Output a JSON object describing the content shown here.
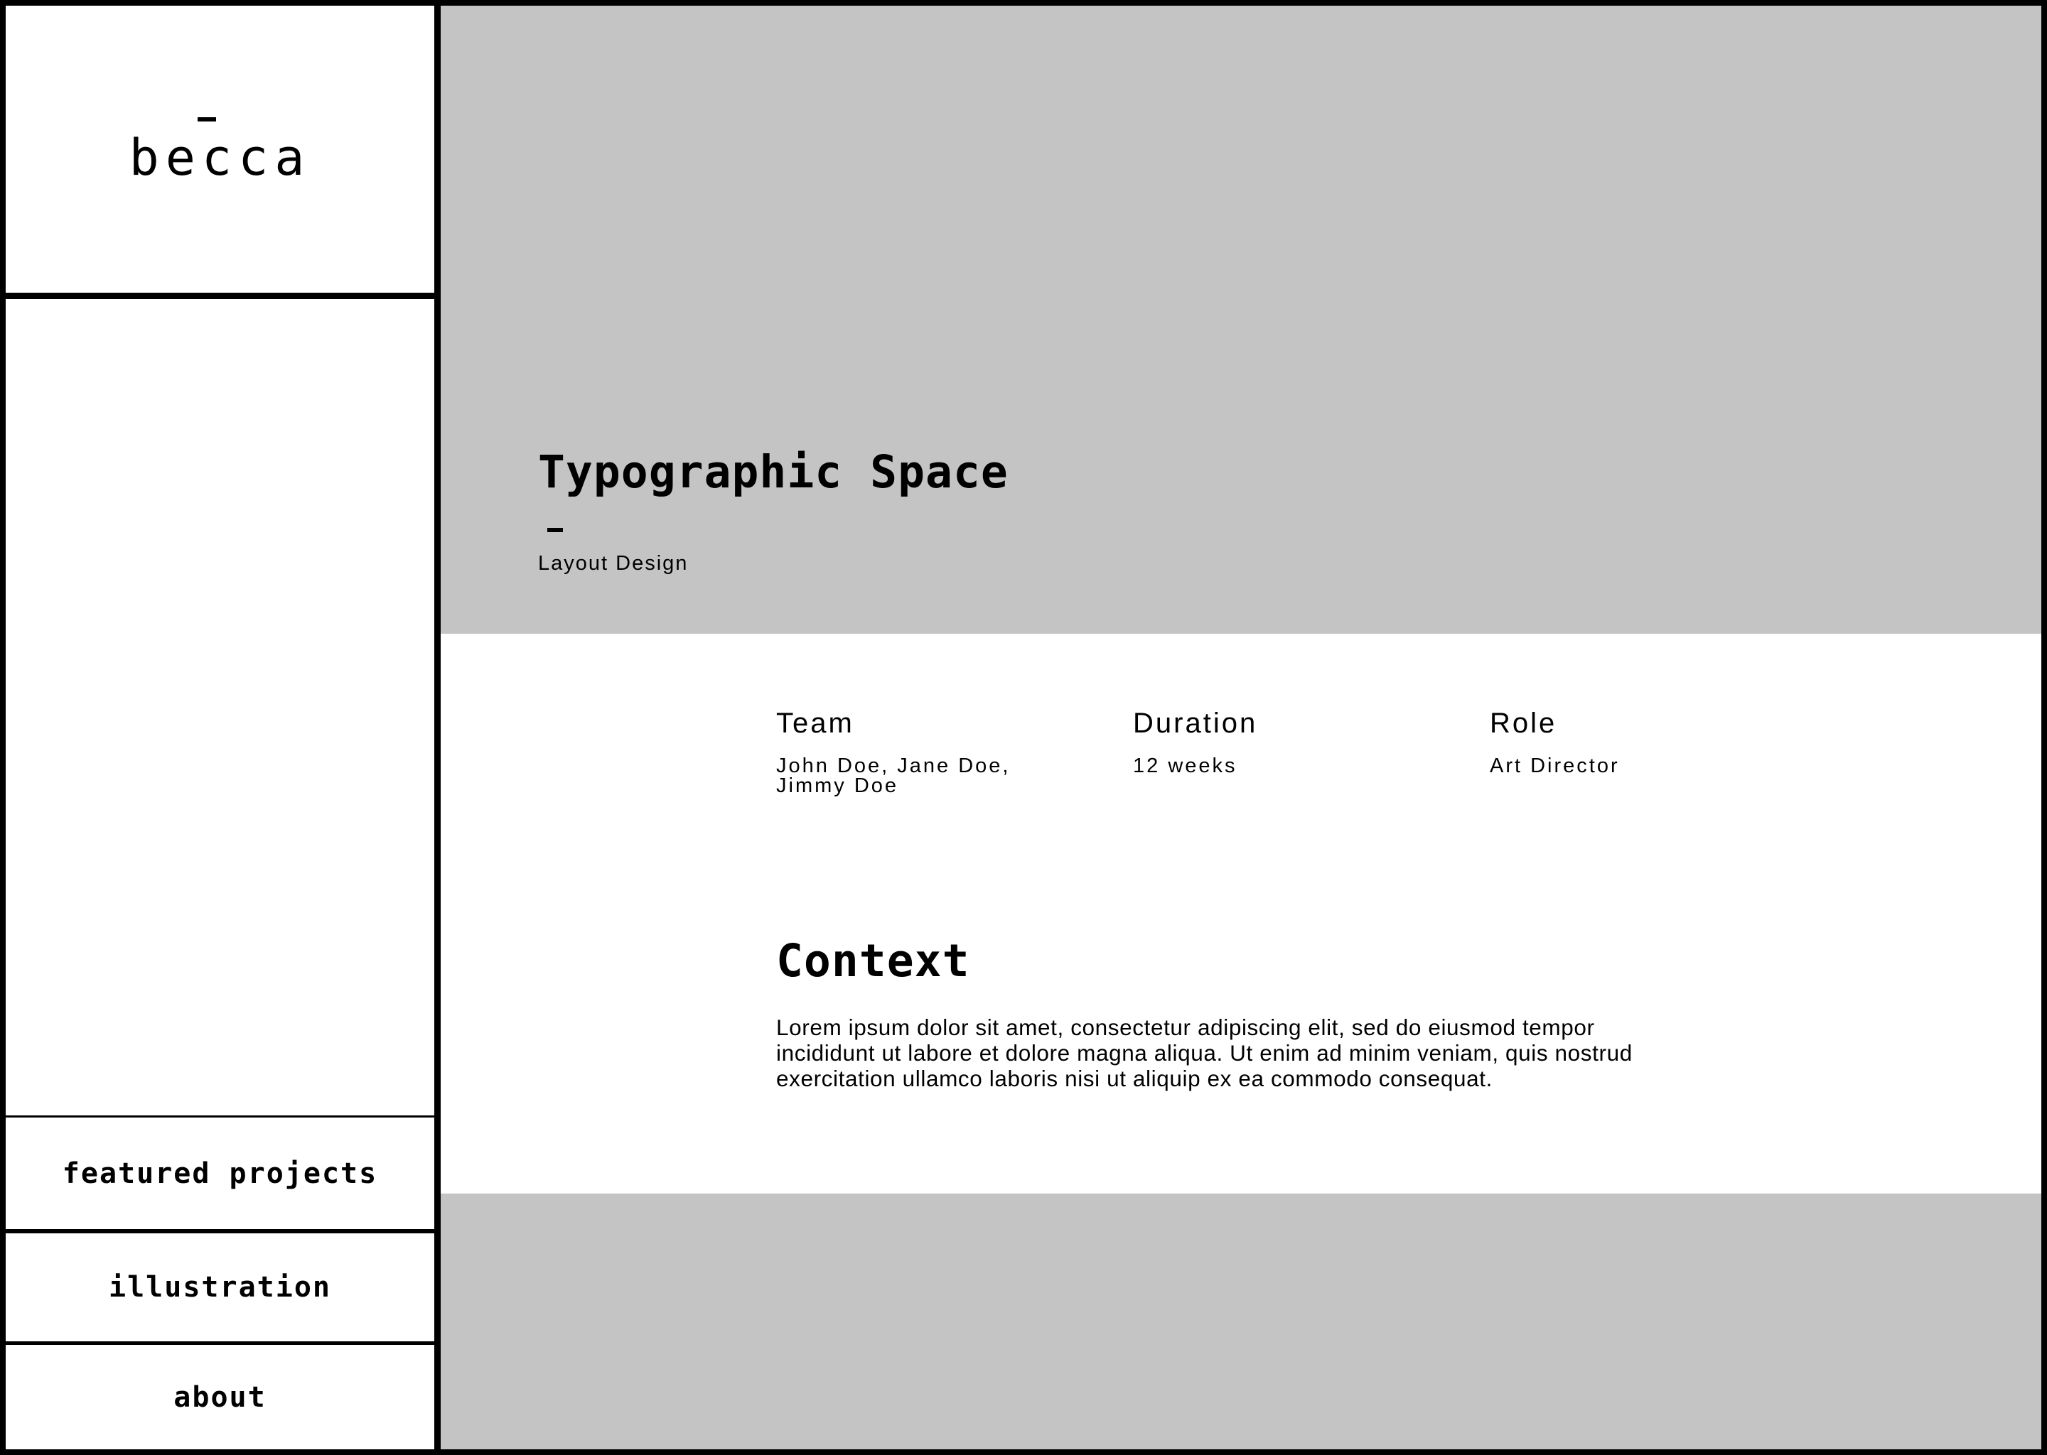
{
  "brand": {
    "logo_text": "becca"
  },
  "nav": {
    "items": [
      {
        "label": "featured projects"
      },
      {
        "label": "illustration"
      },
      {
        "label": "about"
      }
    ]
  },
  "project": {
    "title": "Typographic Space",
    "subtitle": "Layout Design",
    "meta": [
      {
        "label": "Team",
        "value": "John Doe, Jane Doe,\nJimmy Doe"
      },
      {
        "label": "Duration",
        "value": "12 weeks"
      },
      {
        "label": "Role",
        "value": "Art Director"
      }
    ],
    "context": {
      "heading": "Context",
      "body": "Lorem ipsum dolor sit amet, consectetur adipiscing elit, sed do eiusmod tempor incididunt ut labore et dolore magna aliqua. Ut enim ad minim veniam, quis nostrud exercitation ullamco laboris nisi ut aliquip ex ea commodo consequat."
    }
  },
  "colors": {
    "frame": "#000000",
    "panel_gray": "#c4c4c4",
    "background": "#ffffff",
    "text": "#000000"
  }
}
